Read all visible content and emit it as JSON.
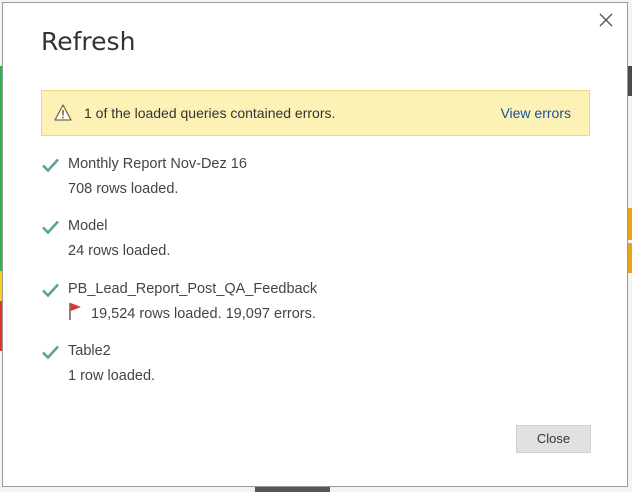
{
  "dialog": {
    "title": "Refresh",
    "close_icon": "close-x-icon",
    "close_button_label": "Close"
  },
  "warning": {
    "icon": "warning-triangle-icon",
    "message": "1 of the loaded queries contained errors.",
    "link_label": "View errors",
    "background_color": "#fdf2b5",
    "link_color": "#1a4f98"
  },
  "queries": [
    {
      "name": "Monthly Report Nov-Dez 16",
      "status": "708 rows loaded.",
      "icon": "checkmark-icon"
    },
    {
      "name": "Model",
      "status": "24 rows loaded.",
      "icon": "checkmark-icon"
    },
    {
      "name": "PB_Lead_Report_Post_QA_Feedback",
      "status": "19,524 rows loaded. 19,097 errors.",
      "icon": "checkmark-icon",
      "error_icon": "red-flag-icon"
    },
    {
      "name": "Table2",
      "status": "1 row loaded.",
      "icon": "checkmark-icon"
    }
  ],
  "colors": {
    "check": "#5aa39b",
    "flag": "#e0352a"
  }
}
